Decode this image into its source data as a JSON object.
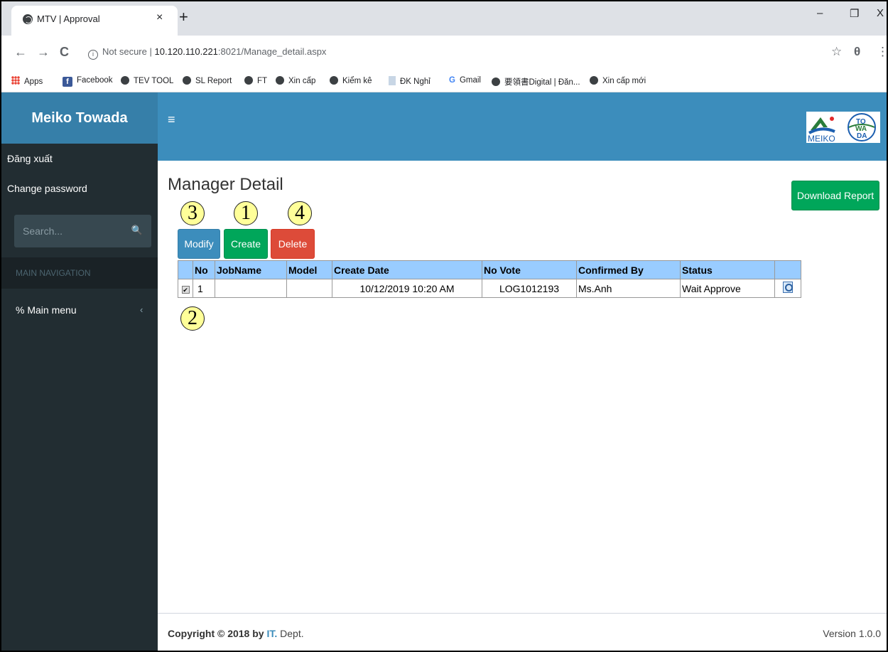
{
  "browser": {
    "tab_title": "MTV | Approval",
    "tab_close": "×",
    "new_tab": "+",
    "window_controls": [
      "–",
      "❐",
      "X"
    ],
    "nav": {
      "back": "←",
      "forward": "→",
      "reload": "C"
    },
    "security_label": "Not secure",
    "url_separator": "|",
    "url_host": "10.120.110.221",
    "url_rest": ":8021/Manage_detail.aspx",
    "star": "☆",
    "profile": "θ",
    "menu": "⋮",
    "bookmarks": [
      {
        "label": "Apps",
        "icon": "apps-icon"
      },
      {
        "label": "Facebook",
        "icon": "facebook-icon"
      },
      {
        "label": "TEV TOOL",
        "icon": "globe-icon"
      },
      {
        "label": "SL Report",
        "icon": "globe-icon"
      },
      {
        "label": "FT",
        "icon": "globe-icon"
      },
      {
        "label": "Xin cấp",
        "icon": "globe-icon"
      },
      {
        "label": "Kiểm kê",
        "icon": "globe-icon"
      },
      {
        "label": "ĐK Nghỉ",
        "icon": "document-icon"
      },
      {
        "label": "Gmail",
        "icon": "google-icon"
      },
      {
        "label": "要領書Digital | Đăn...",
        "icon": "globe-icon"
      },
      {
        "label": "Xin cấp mới",
        "icon": "globe-icon"
      }
    ]
  },
  "sidebar": {
    "brand": "Meiko Towada",
    "logout": "Đăng xuất",
    "change_password": "Change password",
    "search_placeholder": "Search...",
    "search_icon": "🔍",
    "header": "MAIN NAVIGATION",
    "menu_label": "Main menu",
    "menu_icon": "%",
    "menu_chevron": "‹"
  },
  "topbar": {
    "hamburger": "≡",
    "logo_text": "MEIKO",
    "logo_badge": "TO WA DA"
  },
  "main": {
    "title": "Manager Detail",
    "download_label": "Download Report",
    "markers": {
      "modify": "3",
      "create": "1",
      "delete": "4",
      "row": "2"
    },
    "buttons": {
      "modify": "Modify",
      "create": "Create",
      "delete": "Delete"
    },
    "table": {
      "headers": [
        "",
        "No",
        "JobName",
        "Model",
        "Create Date",
        "No Vote",
        "Confirmed By",
        "Status",
        ""
      ],
      "rows": [
        {
          "checked": "✔",
          "no": "1",
          "job_name": "",
          "model": "",
          "create_date": "10/12/2019 10:20 AM",
          "no_vote": "LOG1012193",
          "confirmed_by": "Ms.Anh",
          "status": "Wait Approve"
        }
      ]
    }
  },
  "footer": {
    "copyright": "Copyright © 2018 by ",
    "dept_prefix": "IT.",
    "dept_suffix": " Dept.",
    "version": "Version 1.0.0"
  },
  "colors": {
    "brand_blue": "#367fa9",
    "topbar_blue": "#3c8dbc",
    "sidebar_dark": "#222d32",
    "success_green": "#00a65a",
    "danger_red": "#dd4b39",
    "table_header": "#99ccff",
    "marker_yellow": "#ffff99"
  }
}
